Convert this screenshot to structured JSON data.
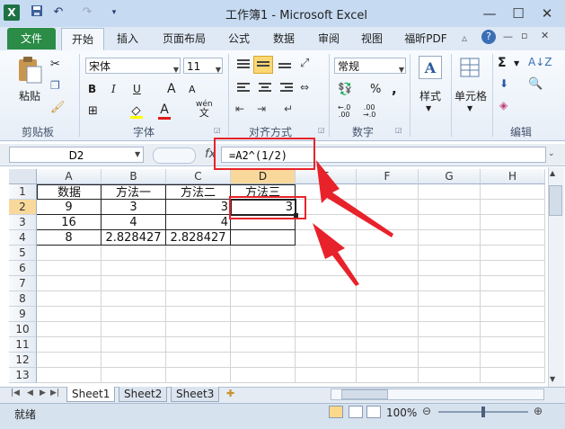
{
  "window": {
    "title": "工作簿1 - Microsoft Excel",
    "app_icon": "X",
    "minimize": "—",
    "restore": "☐",
    "close": "✕"
  },
  "ribbon_tabs": [
    "文件",
    "开始",
    "插入",
    "页面布局",
    "公式",
    "数据",
    "审阅",
    "视图",
    "福昕PDF"
  ],
  "ribbon": {
    "paste_label": "粘贴",
    "clipboard_label": "剪贴板",
    "font_name": "宋体",
    "font_size": "11",
    "font_label": "字体",
    "bold": "B",
    "italic": "I",
    "underline": "U",
    "font_grow": "A",
    "font_shrink": "A",
    "wen": "wén",
    "font_color_a": "A",
    "align_label": "对齐方式",
    "number_format": "常规",
    "number_label": "数字",
    "percent": "%",
    "comma": ",",
    "styles_label": "样式",
    "cells_label": "单元格",
    "editing_label": "编辑",
    "sigma": "Σ"
  },
  "formula_bar": {
    "name_box": "D2",
    "fx": "fx",
    "formula": "=A2^(1/2)"
  },
  "grid": {
    "columns": [
      "A",
      "B",
      "C",
      "D",
      "E",
      "F",
      "G",
      "H"
    ],
    "rows": [
      "1",
      "2",
      "3",
      "4",
      "5",
      "6",
      "7",
      "8",
      "9",
      "10",
      "11",
      "12",
      "13"
    ],
    "cells": {
      "A1": "数据",
      "B1": "方法一",
      "C1": "方法二",
      "D1": "方法三",
      "A2": "9",
      "B2": "3",
      "C2": "3",
      "D2": "3",
      "A3": "16",
      "B3": "4",
      "C3": "4",
      "A4": "8",
      "B4": "2.828427",
      "C4": "2.828427"
    }
  },
  "sheets": [
    "Sheet1",
    "Sheet2",
    "Sheet3"
  ],
  "status": {
    "ready": "就绪",
    "zoom": "100%"
  },
  "colors": {
    "file_tab": "#2a8c46",
    "annotation_red": "#e8222a",
    "selected_header": "#f9d99b"
  }
}
